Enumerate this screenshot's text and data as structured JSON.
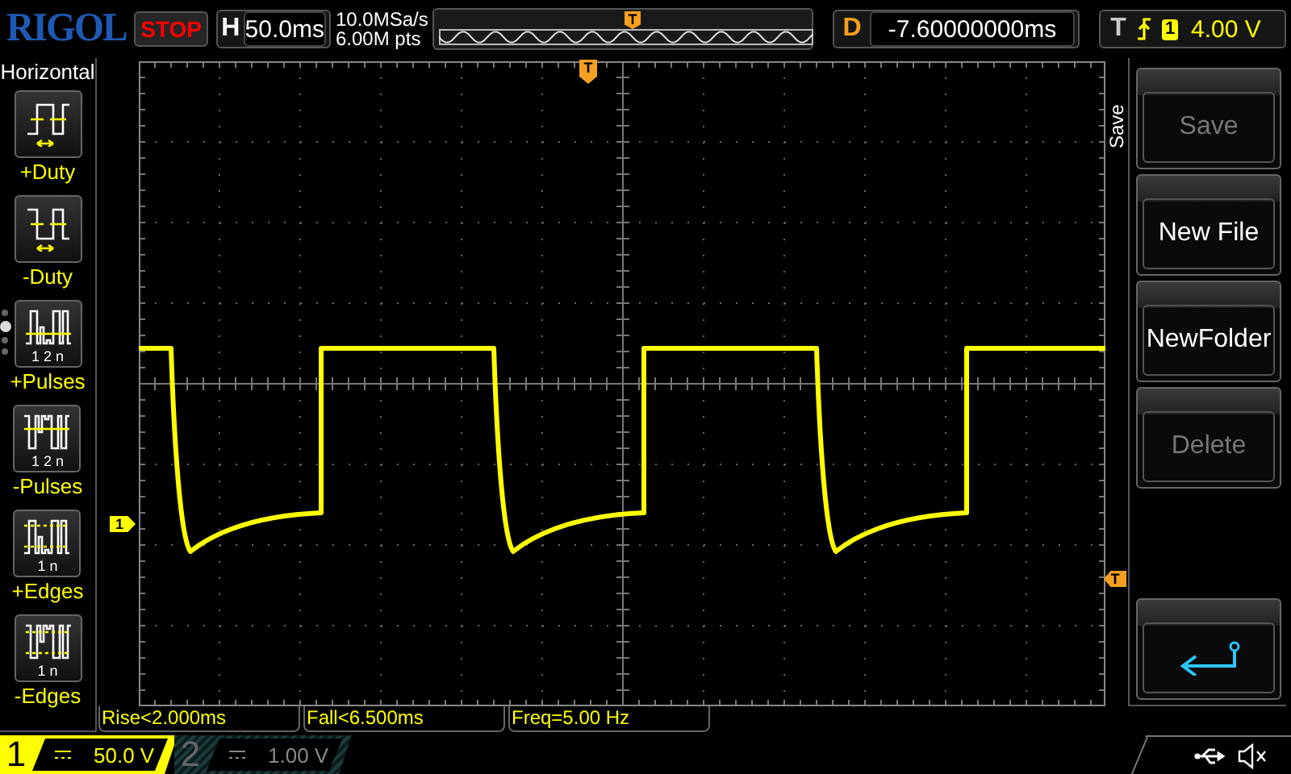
{
  "brand": "RIGOL",
  "run_state": "STOP",
  "timebase": {
    "label": "H",
    "value": "50.0ms"
  },
  "sampling": {
    "rate": "10.0MSa/s",
    "depth": "6.00M pts"
  },
  "memory_bar": {
    "trigger_marker": "T"
  },
  "delay": {
    "label": "D",
    "value": "-7.60000000ms"
  },
  "trigger": {
    "label": "T",
    "channel": "1",
    "level": "4.00 V"
  },
  "measure_menu": {
    "title": "Horizontal",
    "items": [
      {
        "label": "+Duty",
        "kind": "plusduty"
      },
      {
        "label": "-Duty",
        "kind": "minusduty"
      },
      {
        "label": "+Pulses",
        "kind": "pluspulses",
        "caption": "1 2 n"
      },
      {
        "label": "-Pulses",
        "kind": "minuspulses",
        "caption": "1 2 n"
      },
      {
        "label": "+Edges",
        "kind": "plusedges",
        "caption": "1 n"
      },
      {
        "label": "-Edges",
        "kind": "minusedges",
        "caption": "1 n"
      }
    ],
    "pages": [
      {
        "selected": false
      },
      {
        "selected": true
      },
      {
        "selected": false
      },
      {
        "selected": false
      }
    ]
  },
  "screen": {
    "trigger_position_marker": "T",
    "channel_marker": "1",
    "trigger_level_marker": "T"
  },
  "side_menu": {
    "title": "Save",
    "buttons": [
      {
        "kind": "text",
        "label": "Save",
        "disabled": true
      },
      {
        "kind": "text",
        "label": "New File",
        "disabled": false
      },
      {
        "kind": "text",
        "label": "NewFolder",
        "disabled": false
      },
      {
        "kind": "text",
        "label": "Delete",
        "disabled": true
      },
      {
        "kind": "back",
        "disabled": false
      }
    ]
  },
  "measurements": [
    "Rise<2.000ms",
    "Fall<6.500ms",
    "Freq=5.00 Hz"
  ],
  "channels": [
    {
      "number": "1",
      "scale": "50.0 V",
      "on": true
    },
    {
      "number": "2",
      "scale": "1.00 V",
      "on": false
    }
  ]
}
